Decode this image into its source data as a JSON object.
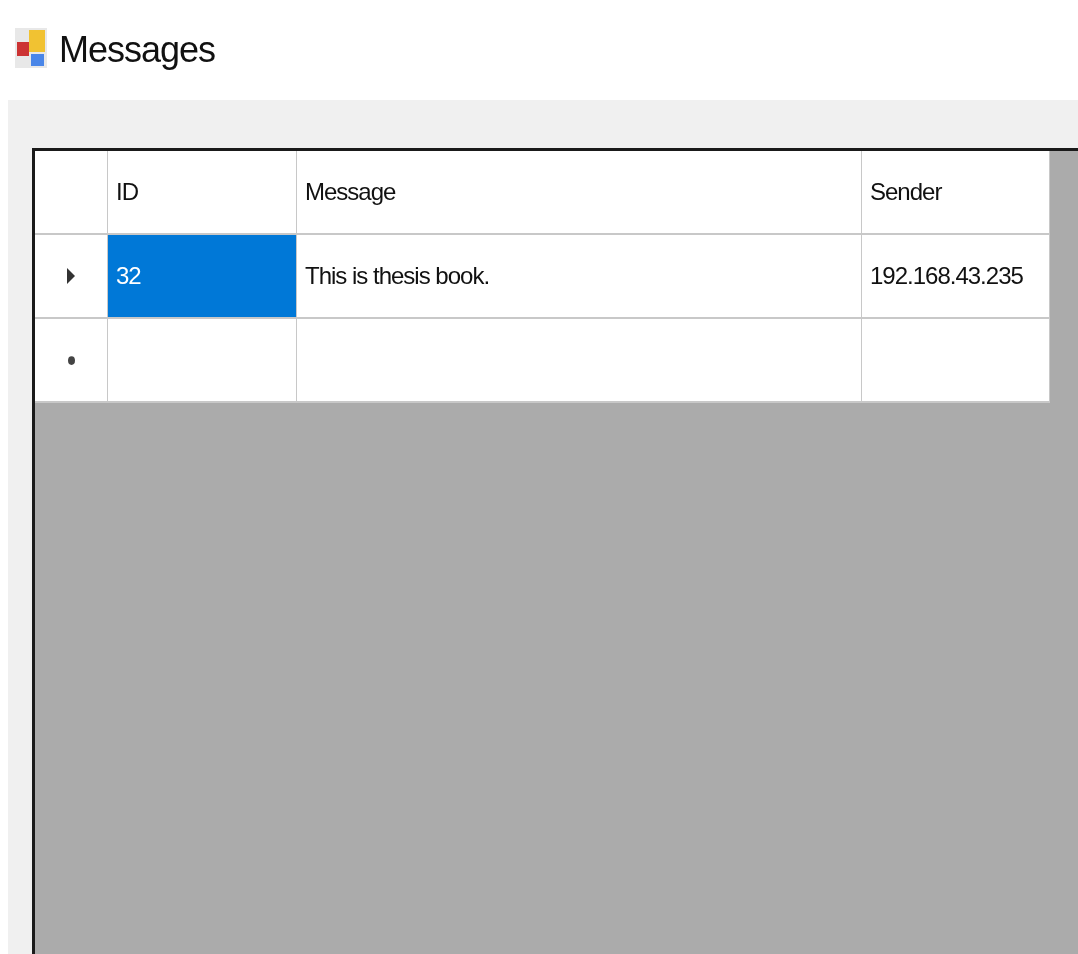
{
  "window": {
    "title": "Messages"
  },
  "table": {
    "columns": [
      {
        "label": "ID"
      },
      {
        "label": "Message"
      },
      {
        "label": "Sender"
      }
    ],
    "rows": [
      {
        "kind": "current",
        "cells": [
          {
            "text": "32",
            "selected": true
          },
          {
            "text": "This is thesis book.",
            "selected": false
          },
          {
            "text": "192.168.43.235",
            "selected": false
          }
        ]
      },
      {
        "kind": "new"
      }
    ]
  }
}
